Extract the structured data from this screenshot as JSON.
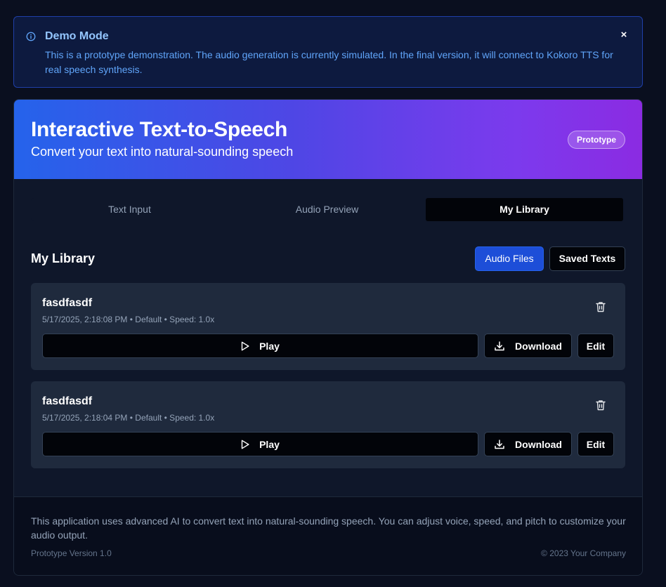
{
  "banner": {
    "title": "Demo Mode",
    "text": "This is a prototype demonstration. The audio generation is currently simulated. In the final version, it will connect to Kokoro TTS for real speech synthesis.",
    "close_label": "×"
  },
  "header": {
    "title": "Interactive Text-to-Speech",
    "subtitle": "Convert your text into natural-sounding speech",
    "badge": "Prototype"
  },
  "tabs": [
    {
      "label": "Text Input",
      "active": false
    },
    {
      "label": "Audio Preview",
      "active": false
    },
    {
      "label": "My Library",
      "active": true
    }
  ],
  "library": {
    "title": "My Library",
    "toggle_audio": "Audio Files",
    "toggle_texts": "Saved Texts",
    "items": [
      {
        "title": "fasdfasdf",
        "meta": "5/17/2025, 2:18:08 PM • Default • Speed: 1.0x",
        "play": "Play",
        "download": "Download",
        "edit": "Edit"
      },
      {
        "title": "fasdfasdf",
        "meta": "5/17/2025, 2:18:04 PM • Default • Speed: 1.0x",
        "play": "Play",
        "download": "Download",
        "edit": "Edit"
      }
    ]
  },
  "footer": {
    "description": "This application uses advanced AI to convert text into natural-sounding speech. You can adjust voice, speed, and pitch to customize your audio output.",
    "version": "Prototype Version 1.0",
    "copyright": "© 2023 Your Company"
  },
  "colors": {
    "background": "#0a0f1f",
    "accent": "#1d4ed8",
    "gradient_start": "#2563eb",
    "gradient_end": "#8b2be2"
  },
  "icons": [
    "info-icon",
    "close-icon",
    "trash-icon",
    "play-icon",
    "download-icon"
  ]
}
